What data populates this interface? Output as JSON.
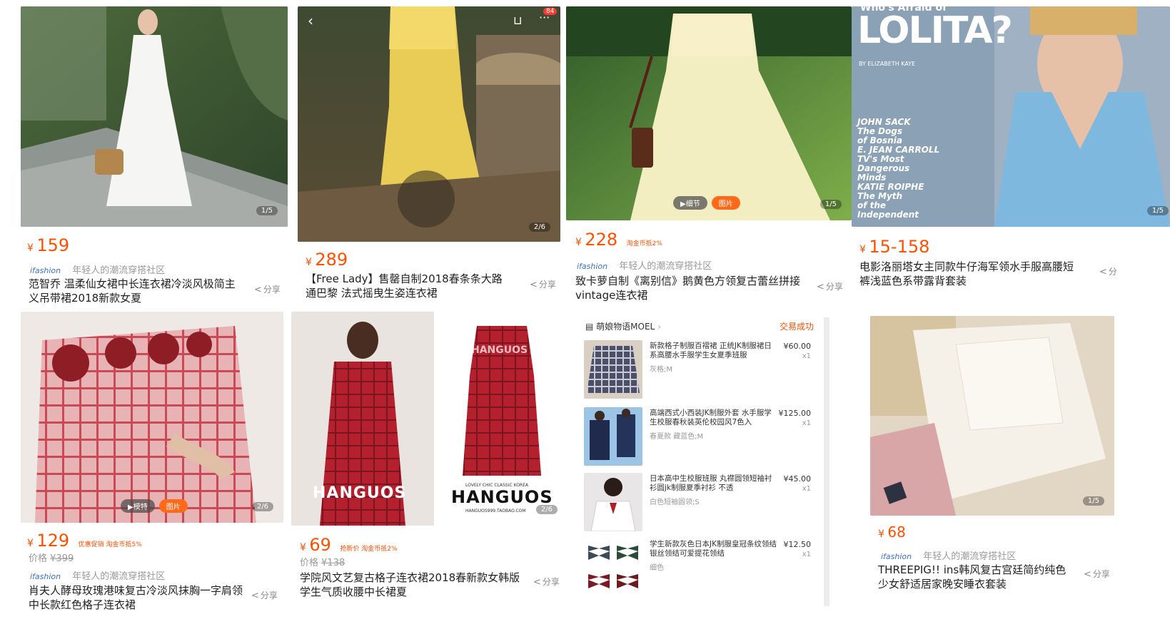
{
  "card1": {
    "pager": "1/5",
    "price_symbol": "¥",
    "price": "159",
    "brand_logo": "ifashion",
    "brand_text": "年轻人的潮流穿搭社区",
    "title": "范智乔 温柔仙女裙中长连衣裙冷淡风极简主义吊带裙2018新款女夏",
    "share": "分享",
    "share_icon": "share-icon"
  },
  "card2": {
    "cart_badge": "84",
    "pager": "2/6",
    "price_symbol": "¥",
    "price": "289",
    "title": "【Free Lady】售罄自制2018春条条大路通巴黎 法式摇曳生姿连衣裙",
    "share": "分享"
  },
  "card3": {
    "pill_video": "▶细节",
    "pill_photo": "图片",
    "pager": "1/5",
    "price_symbol": "¥",
    "price": "228",
    "tagline": "淘金币抵2%",
    "brand_logo": "ifashion",
    "brand_text": "年轻人的潮流穿搭社区",
    "title": "致卡萝自制《离别信》鹅黄色方领复古蕾丝拼接vintage连衣裙",
    "share": "分享"
  },
  "card4": {
    "mag_title": "LOLITA?",
    "mag_top": "Who's Afraid of",
    "mag_byline": "BY ELIZABETH KAYE",
    "mag_lines": [
      "JOHN SACK",
      "The Dogs",
      "of Bosnia",
      "E. JEAN CARROLL",
      "TV's Most",
      "Dangerous",
      "Minds",
      "KATIE ROIPHE",
      "The Myth",
      "of the",
      "Independent"
    ],
    "pager": "1/5",
    "price_symbol": "¥",
    "price": "15-158",
    "title": "电影洛丽塔女主同款牛仔海军领水手服高腰短裤浅蓝色系带露背套装",
    "share": "分"
  },
  "card5": {
    "pill_video": "▶模特",
    "pill_photo": "图片",
    "pager": "2/6",
    "price_symbol": "¥",
    "price": "129",
    "tagline": "优惠促销   淘金币抵5%",
    "orig_label": "价格",
    "orig_price": "¥399",
    "brand_logo": "ifashion",
    "brand_text": "年轻人的潮流穿搭社区",
    "title": "肖夫人酵母玫瑰港味复古冷淡风抹胸一字肩领中长款红色格子连衣裙",
    "share": "分享"
  },
  "card6": {
    "logo_left": "HANGUOS",
    "logo_right": "HANGUOS",
    "logo_right_top": "LOVELY CHIC CLASSIC KOREA",
    "logo_right_sub": "HANGUOS999.TAOBAO.COM",
    "watermark": "HANGUOS",
    "pager": "2/6",
    "price_symbol": "¥",
    "price": "69",
    "tagline": "抢新价   淘金币抵2%",
    "orig_label": "价格",
    "orig_price": "¥138",
    "title": "学院风文艺复古格子连衣裙2018春新款女韩版学生气质收腰中长裙夏",
    "share": "分享"
  },
  "order": {
    "shop_name": "萌娘物语MOEL",
    "status": "交易成功",
    "items": [
      {
        "name": "新款格子制服百褶裙 正统JK制服裙日系高腰水手服学生女夏季班服",
        "sku": "灰格;M",
        "price": "¥60.00",
        "qty": "x1"
      },
      {
        "name": "高端西式小西装JK制服外套 水手服学生校服春秋装英伦校园风7色入",
        "sku": "春夏款 藏蓝色;M",
        "price": "¥125.00",
        "qty": "x1"
      },
      {
        "name": "日本高中生校服班服 丸襟圆领短袖衬衫圆jk制服夏季衬衫 不透",
        "sku": "白色短袖圆领;S",
        "price": "¥45.00",
        "qty": "x1"
      },
      {
        "name": "学生新款灰色日本JK制服皇冠条纹领结 银丝领结可爱提花领结",
        "sku": "细色",
        "price": "¥12.50",
        "qty": "x1"
      }
    ]
  },
  "card8": {
    "pager": "1/5",
    "price_symbol": "¥",
    "price": "68",
    "brand_logo": "ifashion",
    "brand_text": "年轻人的潮流穿搭社区",
    "title": "THREEPIG!! ins韩风复古宫廷简约纯色少女舒适居家晚安睡衣套装",
    "share": "分享"
  },
  "colors": {
    "accent": "#ff5000",
    "brand_blue": "#3b6fd0"
  }
}
